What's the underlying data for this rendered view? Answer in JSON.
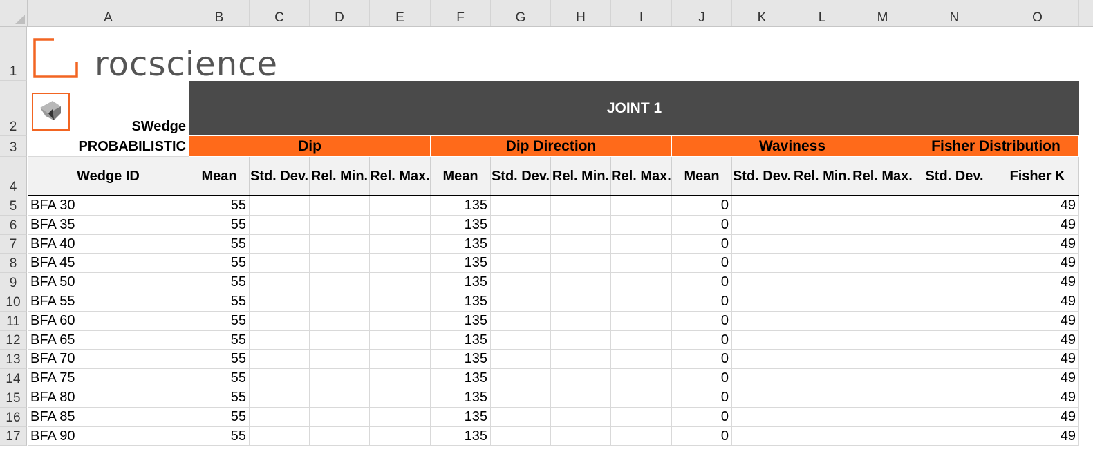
{
  "columns": [
    "A",
    "B",
    "C",
    "D",
    "E",
    "F",
    "G",
    "H",
    "I",
    "J",
    "K",
    "L",
    "M",
    "N",
    "O"
  ],
  "logo": {
    "text": "rocscience",
    "accent": "#f26522"
  },
  "swedge": {
    "label": "SWedge",
    "subtitle": "PROBABILISTIC"
  },
  "joint_title": "JOINT 1",
  "groups": {
    "dip": "Dip",
    "dip_direction": "Dip Direction",
    "waviness": "Waviness",
    "fisher": "Fisher Distribution"
  },
  "subheaders": {
    "wedge_id": "Wedge ID",
    "dip_mean": "Mean",
    "dip_std": "Std. Dev.",
    "dip_relmin": "Rel. Min.",
    "dip_relmax": "Rel. Max.",
    "dd_mean": "Mean",
    "dd_std": "Std. Dev.",
    "dd_relmin": "Rel. Min.",
    "dd_relmax": "Rel. Max.",
    "wav_mean": "Mean",
    "wav_std": "Std. Dev.",
    "wav_relmin": "Rel. Min.",
    "wav_relmax": "Rel. Max.",
    "fisher_std": "Std. Dev.",
    "fisher_k": "Fisher K"
  },
  "rows": [
    {
      "n": "5",
      "id": "BFA 30",
      "dip": "55",
      "dd": "135",
      "wav": "0",
      "k": "49"
    },
    {
      "n": "6",
      "id": "BFA 35",
      "dip": "55",
      "dd": "135",
      "wav": "0",
      "k": "49"
    },
    {
      "n": "7",
      "id": "BFA 40",
      "dip": "55",
      "dd": "135",
      "wav": "0",
      "k": "49"
    },
    {
      "n": "8",
      "id": "BFA 45",
      "dip": "55",
      "dd": "135",
      "wav": "0",
      "k": "49"
    },
    {
      "n": "9",
      "id": "BFA 50",
      "dip": "55",
      "dd": "135",
      "wav": "0",
      "k": "49"
    },
    {
      "n": "10",
      "id": "BFA 55",
      "dip": "55",
      "dd": "135",
      "wav": "0",
      "k": "49"
    },
    {
      "n": "11",
      "id": "BFA 60",
      "dip": "55",
      "dd": "135",
      "wav": "0",
      "k": "49"
    },
    {
      "n": "12",
      "id": "BFA 65",
      "dip": "55",
      "dd": "135",
      "wav": "0",
      "k": "49"
    },
    {
      "n": "13",
      "id": "BFA 70",
      "dip": "55",
      "dd": "135",
      "wav": "0",
      "k": "49"
    },
    {
      "n": "14",
      "id": "BFA 75",
      "dip": "55",
      "dd": "135",
      "wav": "0",
      "k": "49"
    },
    {
      "n": "15",
      "id": "BFA 80",
      "dip": "55",
      "dd": "135",
      "wav": "0",
      "k": "49"
    },
    {
      "n": "16",
      "id": "BFA 85",
      "dip": "55",
      "dd": "135",
      "wav": "0",
      "k": "49"
    },
    {
      "n": "17",
      "id": "BFA 90",
      "dip": "55",
      "dd": "135",
      "wav": "0",
      "k": "49"
    }
  ],
  "header_row_numbers": [
    "1",
    "2",
    "3",
    "4"
  ]
}
